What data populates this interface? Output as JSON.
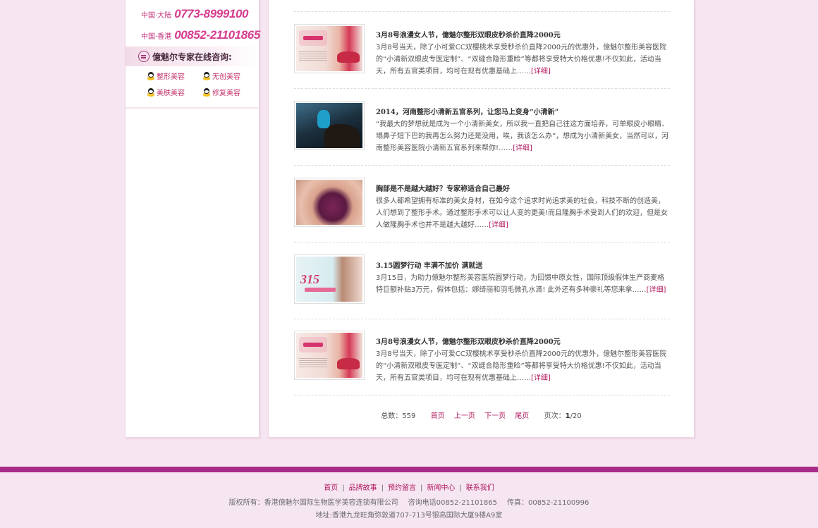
{
  "sidebar": {
    "phones": [
      {
        "region": "中国·大陆",
        "number": "0773-8999100"
      },
      {
        "region": "中国·香港",
        "number": "00852-21101865"
      }
    ],
    "consult_title": "億魅尔专家在线咨询:",
    "qq_links": [
      "整形美容",
      "无创美容",
      "美肤美容",
      "修复美容"
    ]
  },
  "articles": [
    {
      "title": "3月8号浪漫女人节，億魅尔整形双眼皮秒杀价直降2000元",
      "summary": "3月8号当天，除了小可爱CC双樱桃术享受秒杀价直降2000元的优惠外，億魅尔整形美容医院的“小清新双眼皮专医定制”、“双缝合隐形重睑”等都将享受特大价格优惠!不仅如此，活动当天，所有五官类项目，均可在现有优惠基础上……",
      "more": "[详细]",
      "thumb": "lingerie"
    },
    {
      "title": "2014，河南整形小清新五官系列，让您马上变身“小清新”",
      "summary": "“我最大的梦想就是成为一个小清新美女，所以我一直把自己往这方面培养，可单眼皮小眼睛、塌鼻子短下巴的我再怎么努力还是没用，唉，我该怎么办”，想成为小清新美女，当然可以，河南整形美容医院小清新五官系列来帮你!……",
      "more": "[详细]",
      "thumb": "horse"
    },
    {
      "title": "胸部是不是越大越好？专家称适合自己最好",
      "summary": "很多人都希望拥有标准的美女身材，在如今这个追求时尚追求美的社会，科技不断的创造美，人们想到了整形手术。通过整形手术可以让人变的更美!而且隆胸手术受到人们的欢迎，但是女人做隆胸手术也并不是越大越好……",
      "more": "[详细]",
      "thumb": "chest"
    },
    {
      "title": "3.15圆梦行动  丰满不加价  满就送",
      "summary": "3月15日，为助力億魅尔整形美容医院圆梦行动，为回馈中原女性，国际顶级假体生产商麦格特巨额补贴3万元，假体包括：娜绮丽和羽毛微孔水滴! 此外还有多种豪礼等您来拿……",
      "more": "[详细]",
      "thumb": "315"
    },
    {
      "title": "3月8号浪漫女人节，億魅尔整形双眼皮秒杀价直降2000元",
      "summary": "3月8号当天，除了小可爱CC双樱桃术享受秒杀价直降2000元的优惠外，億魅尔整形美容医院的“小清新双眼皮专医定制”、“双缝合隐形重睑”等都将享受特大价格优惠!不仅如此，活动当天，所有五官类项目，均可在现有优惠基础上……",
      "more": "[详细]",
      "thumb": "lingerie"
    }
  ],
  "pager": {
    "total_label": "总数：",
    "total": "559",
    "first": "首页",
    "prev": "上一页",
    "next": "下一页",
    "last": "尾页",
    "page_label": "页次：",
    "current": "1",
    "of": "/20"
  },
  "footer": {
    "nav": [
      "首页",
      "品牌故事",
      "预约留言",
      "新闻中心",
      "联系我们"
    ],
    "copyright": "版权所有：香港億魅尔国际生物医学美容连锁有限公司",
    "phone": "咨询电话00852-21101865",
    "fax": "传真：00852-21100996",
    "address": "地址:香港九龙旺角弥敦道707-713号银高国际大厦9楼A9室"
  },
  "colors": {
    "accent": "#b0195f",
    "phone": "#d63c8e",
    "footer_band": "#a72b88",
    "background": "#f6e6f1"
  }
}
